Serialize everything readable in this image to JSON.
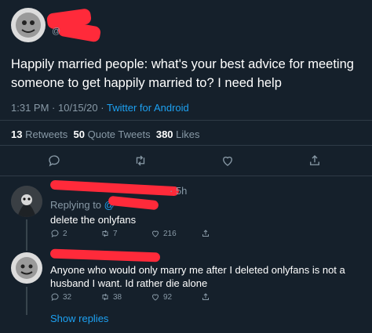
{
  "main_tweet": {
    "handle": "@",
    "text": "Happily married people: what's your best advice for meeting someone to get happily married to? I need help",
    "time": "1:31 PM",
    "date": "10/15/20",
    "separator": "·",
    "source": "Twitter for Android",
    "stats": {
      "retweets_count": "13",
      "retweets_label": "Retweets",
      "quotes_count": "50",
      "quotes_label": "Quote Tweets",
      "likes_count": "380",
      "likes_label": "Likes"
    },
    "actions": [
      "reply-icon",
      "retweet-icon",
      "like-icon",
      "share-icon"
    ]
  },
  "reply1": {
    "time_suffix": "· 5h",
    "replying_label": "Replying to",
    "replying_handle": "@",
    "text": "delete the onlyfans",
    "reply_count": "2",
    "retweet_count": "7",
    "like_count": "216"
  },
  "reply2": {
    "text": "Anyone who would only marry me after I deleted onlyfans is not a husband I want. Id rather die alone",
    "reply_count": "32",
    "retweet_count": "38",
    "like_count": "92"
  },
  "show_replies": "Show replies",
  "colors": {
    "background": "#15202b",
    "muted": "#8899a6",
    "link": "#1da1f2",
    "redaction": "#ff2a3a"
  }
}
